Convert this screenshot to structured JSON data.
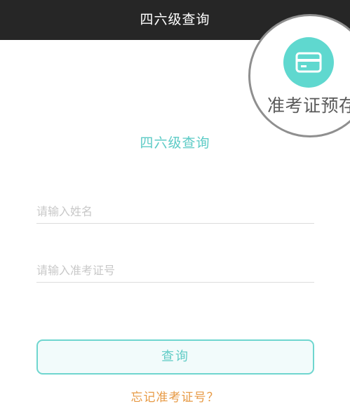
{
  "header": {
    "title": "四六级查询"
  },
  "zoom_badge": {
    "icon": "card-icon",
    "accent_color": "#5fd8cf",
    "label": "准考证预存"
  },
  "form": {
    "heading": "四六级查询",
    "name_placeholder": "请输入姓名",
    "ticket_placeholder": "请输入准考证号",
    "submit_label": "查询",
    "forgot_label": "忘记准考证号？"
  }
}
